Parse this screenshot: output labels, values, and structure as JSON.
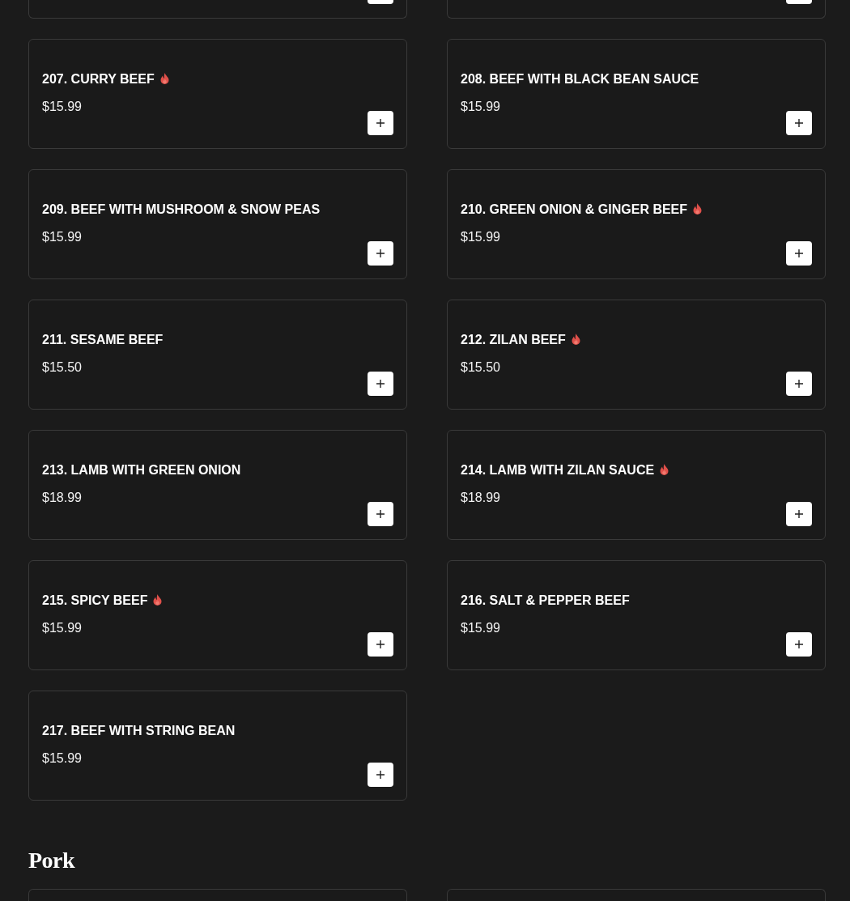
{
  "sections": [
    {
      "items": [
        {
          "kind": "cut_top"
        },
        {
          "kind": "cut_top"
        },
        {
          "kind": "full",
          "name": "207. CURRY BEEF",
          "spicy": true,
          "price": "$15.99"
        },
        {
          "kind": "full",
          "name": "208. BEEF WITH BLACK BEAN SAUCE",
          "spicy": false,
          "price": "$15.99"
        },
        {
          "kind": "full",
          "name": "209. BEEF WITH MUSHROOM & SNOW PEAS",
          "spicy": false,
          "price": "$15.99"
        },
        {
          "kind": "full",
          "name": "210. GREEN ONION & GINGER BEEF",
          "spicy": true,
          "price": "$15.99"
        },
        {
          "kind": "full",
          "name": "211. SESAME BEEF",
          "spicy": false,
          "price": "$15.50"
        },
        {
          "kind": "full",
          "name": "212. ZILAN BEEF",
          "spicy": true,
          "price": "$15.50"
        },
        {
          "kind": "full",
          "name": "213. LAMB WITH GREEN ONION",
          "spicy": false,
          "price": "$18.99"
        },
        {
          "kind": "full",
          "name": "214. LAMB WITH ZILAN SAUCE",
          "spicy": true,
          "price": "$18.99"
        },
        {
          "kind": "full",
          "name": "215. SPICY BEEF",
          "spicy": true,
          "price": "$15.99"
        },
        {
          "kind": "full",
          "name": "216. SALT & PEPPER BEEF",
          "spicy": false,
          "price": "$15.99"
        },
        {
          "kind": "full",
          "name": "217. BEEF WITH STRING BEAN",
          "spicy": false,
          "price": "$15.99"
        }
      ]
    },
    {
      "title": "Pork",
      "items": [
        {
          "kind": "cut_bottom"
        },
        {
          "kind": "cut_bottom"
        }
      ]
    }
  ]
}
